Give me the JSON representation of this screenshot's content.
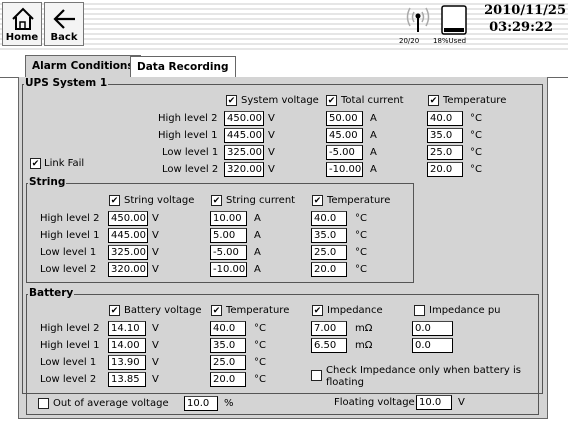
{
  "nav": {
    "home": "Home",
    "back": "Back"
  },
  "status": {
    "signal": "20/20",
    "storage": "18%Used",
    "date": "2010/11/25",
    "time": "03:29:22"
  },
  "tabs": {
    "alarm": "Alarm Conditions",
    "recording": "Data Recording"
  },
  "labels": {
    "high2": "High level 2",
    "high1": "High level 1",
    "low1": "Low level 1",
    "low2": "Low level 2"
  },
  "units": {
    "v": "V",
    "a": "A",
    "c": "°C",
    "mohm": "mΩ",
    "pct": "%"
  },
  "ups": {
    "title": "UPS System 1",
    "sysvolt_label": "System voltage",
    "totcur_label": "Total current",
    "temp_label": "Temperature",
    "linkfail_label": "Link Fail",
    "sysvolt": [
      "450.00",
      "445.00",
      "325.00",
      "320.00"
    ],
    "totcur": [
      "50.00",
      "45.00",
      "-5.00",
      "-10.00"
    ],
    "temp": [
      "40.0",
      "35.0",
      "25.0",
      "20.0"
    ]
  },
  "string": {
    "title": "String",
    "volt_label": "String voltage",
    "cur_label": "String current",
    "temp_label": "Temperature",
    "volt": [
      "450.00",
      "445.00",
      "325.00",
      "320.00"
    ],
    "cur": [
      "10.00",
      "5.00",
      "-5.00",
      "-10.00"
    ],
    "temp": [
      "40.0",
      "35.0",
      "25.0",
      "20.0"
    ]
  },
  "battery": {
    "title": "Battery",
    "volt_label": "Battery voltage",
    "temp_label": "Temperature",
    "imp_label": "Impedance",
    "imppu_label": "Impedance pu",
    "volt": [
      "14.10",
      "14.00",
      "13.90",
      "13.85"
    ],
    "temp": [
      "40.0",
      "35.0",
      "25.0",
      "20.0"
    ],
    "imp": [
      "7.00",
      "6.50"
    ],
    "imppu": [
      "0.0",
      "0.0"
    ],
    "check_imp_label_1": "Check Impedance only when battery is",
    "check_imp_label_2": "floating",
    "float_label": "Floating voltage",
    "float_value": "10.0",
    "outavg_label": "Out of average voltage",
    "outavg_value": "10.0"
  }
}
